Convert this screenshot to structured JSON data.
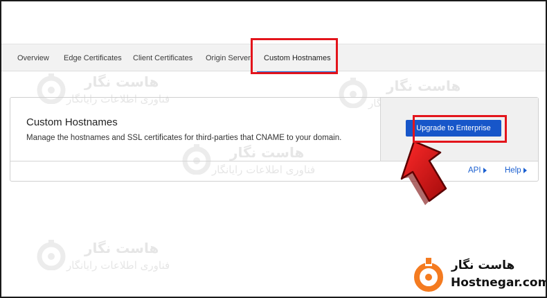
{
  "tabs": [
    {
      "label": "Overview",
      "active": false
    },
    {
      "label": "Edge Certificates",
      "active": false
    },
    {
      "label": "Client Certificates",
      "active": false
    },
    {
      "label": "Origin Server",
      "active": false
    },
    {
      "label": "Custom Hostnames",
      "active": true
    }
  ],
  "card": {
    "title": "Custom Hostnames",
    "description": "Manage the hostnames and SSL certificates for third-parties that CNAME to your domain.",
    "upgrade_button": "Upgrade to Enterprise",
    "footer_links": {
      "api": "API",
      "help": "Help"
    }
  },
  "watermark": {
    "title": "هاست نگار",
    "subtitle": "فناوری اطلاعات رایانگار"
  },
  "brand": {
    "name_fa": "هاست نگار",
    "name_en": "Hostnegar.com"
  },
  "colors": {
    "highlight": "#e3141b",
    "button": "#1756c9",
    "link": "#1a5fd0",
    "arrow": "#d3141b",
    "brand_orange": "#f47b20"
  },
  "icons": {
    "link_arrow": "triangle-right-icon",
    "pointer": "red-arrow-icon",
    "logo": "hostnegar-logo-icon"
  }
}
